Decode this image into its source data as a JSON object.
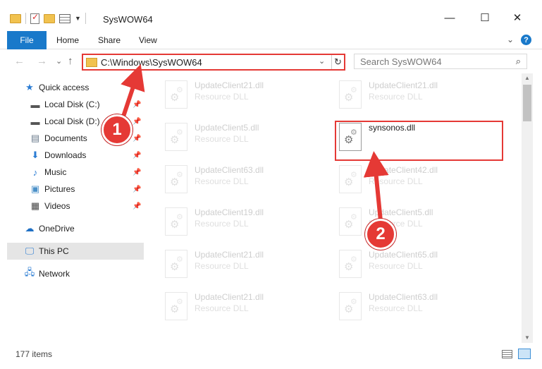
{
  "window": {
    "title": "SysWOW64",
    "minimize": "—",
    "maximize": "☐",
    "close": "✕"
  },
  "ribbon": {
    "tabs": [
      "File",
      "Home",
      "Share",
      "View"
    ],
    "collapse_glyph": "⌄",
    "help_glyph": "?"
  },
  "nav": {
    "back": "←",
    "forward": "→",
    "recent": "⌄",
    "up": "↑",
    "address": "C:\\Windows\\SysWOW64",
    "dropdown": "⌄",
    "refresh": "↻",
    "search_placeholder": "Search SysWOW64"
  },
  "sidebar": {
    "items": [
      {
        "label": "Quick access",
        "icon": "star-icon",
        "glyph": "★",
        "color": "#2b7cd3"
      },
      {
        "label": "Local Disk (C:)",
        "icon": "drive-icon",
        "glyph": "▬",
        "color": "#555555",
        "pin": "📌"
      },
      {
        "label": "Local Disk (D:)",
        "icon": "drive-icon",
        "glyph": "▬",
        "color": "#555555",
        "pin": "📌"
      },
      {
        "label": "Documents",
        "icon": "documents-icon",
        "glyph": "▤",
        "color": "#6b7b8c",
        "pin": "📌"
      },
      {
        "label": "Downloads",
        "icon": "download-icon",
        "glyph": "⬇",
        "color": "#2b7cd3",
        "pin": "📌"
      },
      {
        "label": "Music",
        "icon": "music-icon",
        "glyph": "♪",
        "color": "#2b7cd3",
        "pin": "📌"
      },
      {
        "label": "Pictures",
        "icon": "pictures-icon",
        "glyph": "▣",
        "color": "#4a90c8",
        "pin": "📌"
      },
      {
        "label": "Videos",
        "icon": "videos-icon",
        "glyph": "▦",
        "color": "#444444",
        "pin": "📌"
      },
      {
        "label": "OneDrive",
        "icon": "cloud-icon",
        "glyph": "☁",
        "color": "#1e6fc4"
      },
      {
        "label": "This PC",
        "icon": "computer-icon",
        "glyph": "🖵",
        "color": "#2b7cd3"
      },
      {
        "label": "Network",
        "icon": "network-icon",
        "glyph": "🖧",
        "color": "#2b7cd3"
      }
    ]
  },
  "files": [
    {
      "name": "UpdateClient21.dll",
      "type": "Resource DLL"
    },
    {
      "name": "UpdateClient21.dll",
      "type": "Resource DLL"
    },
    {
      "name": "UpdateClient5.dll",
      "type": "Resource DLL"
    },
    {
      "name": "synsonos.dll",
      "type": ""
    },
    {
      "name": "UpdateClient63.dll",
      "type": "Resource DLL"
    },
    {
      "name": "UpdateClient42.dll",
      "type": "Resource DLL"
    },
    {
      "name": "UpdateClient19.dll",
      "type": "Resource DLL"
    },
    {
      "name": "UpdateClient5.dll",
      "type": "Resource DLL"
    },
    {
      "name": "UpdateClient21.dll",
      "type": "Resource DLL"
    },
    {
      "name": "UpdateClient65.dll",
      "type": "Resource DLL"
    },
    {
      "name": "UpdateClient21.dll",
      "type": "Resource DLL"
    },
    {
      "name": "UpdateClient63.dll",
      "type": "Resource DLL"
    }
  ],
  "status": {
    "item_count": "177 items"
  },
  "annotations": {
    "badge1": "1",
    "badge2": "2",
    "color": "#e53935"
  }
}
